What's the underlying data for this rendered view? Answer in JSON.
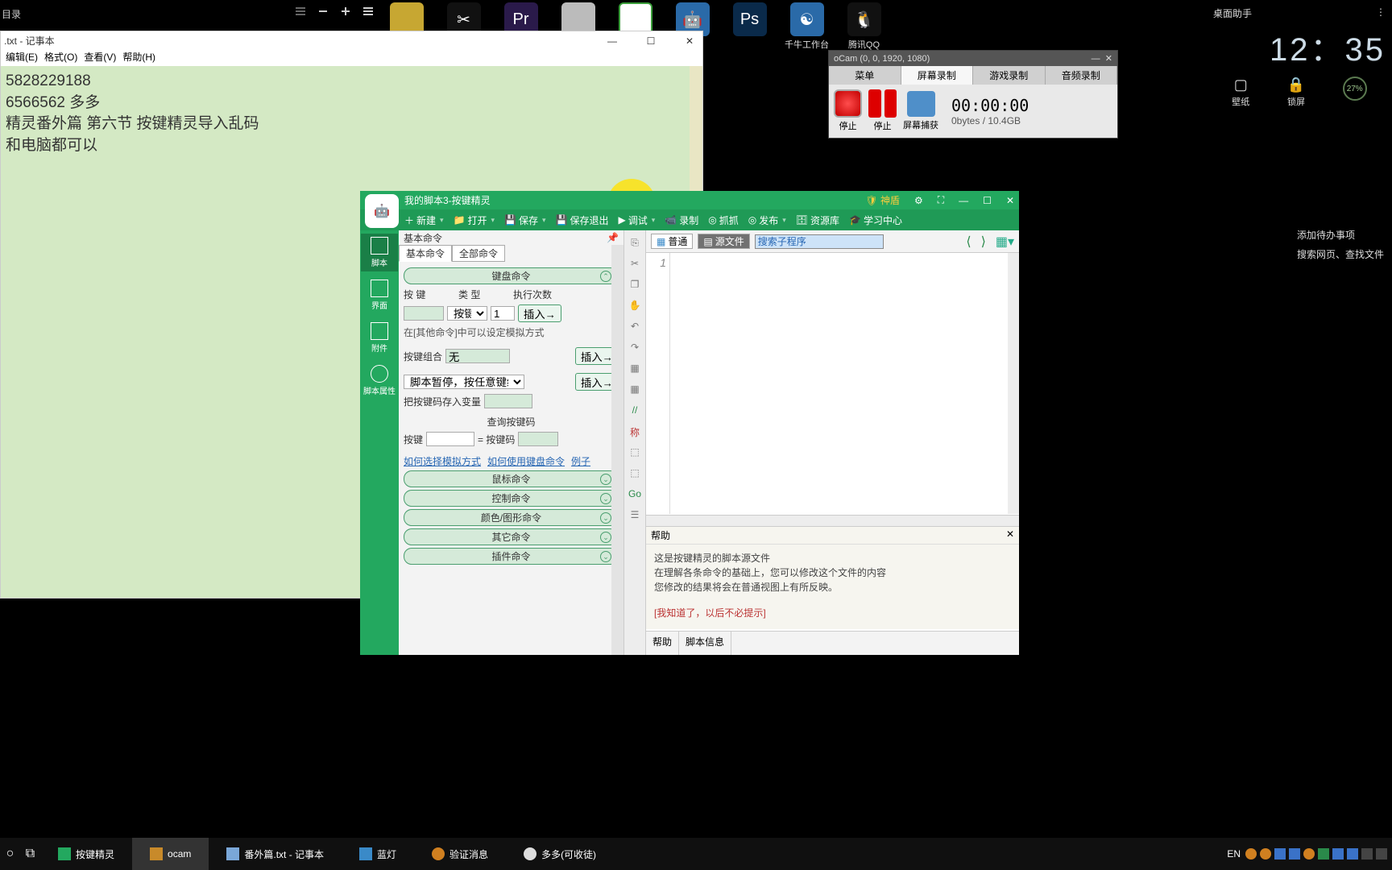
{
  "topbar": {
    "left_label": "目录"
  },
  "dock": [
    {
      "label": "",
      "bg": "#c7a732"
    },
    {
      "label": "",
      "bg": "#111"
    },
    {
      "label": "Pr",
      "bg": "#2a1a4a"
    },
    {
      "label": "",
      "bg": "#a83a3a"
    },
    {
      "label": "",
      "bg": "#3a9e3a"
    },
    {
      "label": "",
      "bg": "#2a6aa8"
    },
    {
      "label": "Ps",
      "bg": "#0a2a4a"
    },
    {
      "label": "千牛工作台",
      "bg": "#2a6aa8"
    },
    {
      "label": "腾讯QQ",
      "bg": "#111"
    }
  ],
  "widget": {
    "title": "桌面助手",
    "clock": "12：35",
    "items": [
      "壁纸",
      "锁屏"
    ],
    "pct": "27%",
    "todo": "添加待办事项",
    "search_hint": "搜索网页、查找文件"
  },
  "notepad": {
    "title": ".txt - 记事本",
    "menu": [
      "编辑(E)",
      "格式(O)",
      "查看(V)",
      "帮助(H)"
    ],
    "lines": [
      "5828229188",
      "6566562 多多",
      "精灵番外篇  第六节  按键精灵导入乱码",
      "",
      "和电脑都可以"
    ]
  },
  "ocam": {
    "title": "oCam (0, 0, 1920, 1080)",
    "tabs": [
      "菜单",
      "屏幕录制",
      "游戏录制",
      "音频录制"
    ],
    "active_tab": 1,
    "btns": [
      "停止",
      "停止",
      "屏幕捕获"
    ],
    "time": "00:00:00",
    "size": "0bytes / 10.4GB"
  },
  "qm": {
    "title": "我的脚本3-按键精灵",
    "shield": "神盾",
    "toolbar": [
      "新建",
      "打开",
      "保存",
      "保存退出",
      "调试",
      "录制",
      "抓抓",
      "发布",
      "资源库",
      "学习中心"
    ],
    "side": [
      "脚本",
      "界面",
      "附件",
      "脚本属性"
    ],
    "cmd": {
      "header": "基本命令",
      "tabs": [
        "基本命令",
        "全部命令"
      ],
      "sections": {
        "keyboard": "键盘命令",
        "layout_labels": {
          "key": "按 键",
          "type": "类 型",
          "count": "执行次数"
        },
        "type_options": "按键",
        "count_val": "1",
        "insert": "插入→",
        "note1": "在[其他命令]中可以设定模拟方式",
        "combo_label": "按键组合",
        "combo_val": "无",
        "pause": "脚本暂停，按任意键继续",
        "store": "把按键码存入变量",
        "lookup": "查询按键码",
        "key_label": "按键",
        "code_label": "= 按键码",
        "links": [
          "如何选择模拟方式",
          "如何使用键盘命令",
          "例子"
        ],
        "others": [
          "鼠标命令",
          "控制命令",
          "颜色/图形命令",
          "其它命令",
          "插件命令"
        ]
      }
    },
    "main": {
      "tab_normal": "普通",
      "tab_source": "源文件",
      "search_value": "搜索子程序",
      "gutter": "1",
      "strip": [
        "⎘",
        "✂",
        "❐",
        "✋",
        "↶",
        "↷",
        "",
        "",
        "//",
        "称",
        "",
        "",
        "Go",
        ""
      ]
    },
    "help": {
      "title": "帮助",
      "lines": [
        "这是按键精灵的脚本源文件",
        "在理解各条命令的基础上，您可以修改这个文件的内容",
        "您修改的结果将会在普通视图上有所反映。"
      ],
      "confirm": "[我知道了，以后不必提示]",
      "btabs": [
        "帮助",
        "脚本信息"
      ]
    }
  },
  "taskbar": {
    "items": [
      {
        "label": "按键精灵",
        "active": false,
        "color": "#23a85f"
      },
      {
        "label": "ocam",
        "active": true,
        "color": "#c88a2a"
      },
      {
        "label": "番外篇.txt - 记事本",
        "active": false,
        "color": "#7aa7d8"
      },
      {
        "label": "蓝灯",
        "active": false,
        "color": "#3a8ac8"
      },
      {
        "label": "验证消息",
        "active": false,
        "color": "#d08020"
      },
      {
        "label": "多多(可收徒)",
        "active": false,
        "color": "#ddd"
      }
    ],
    "lang": "EN"
  }
}
